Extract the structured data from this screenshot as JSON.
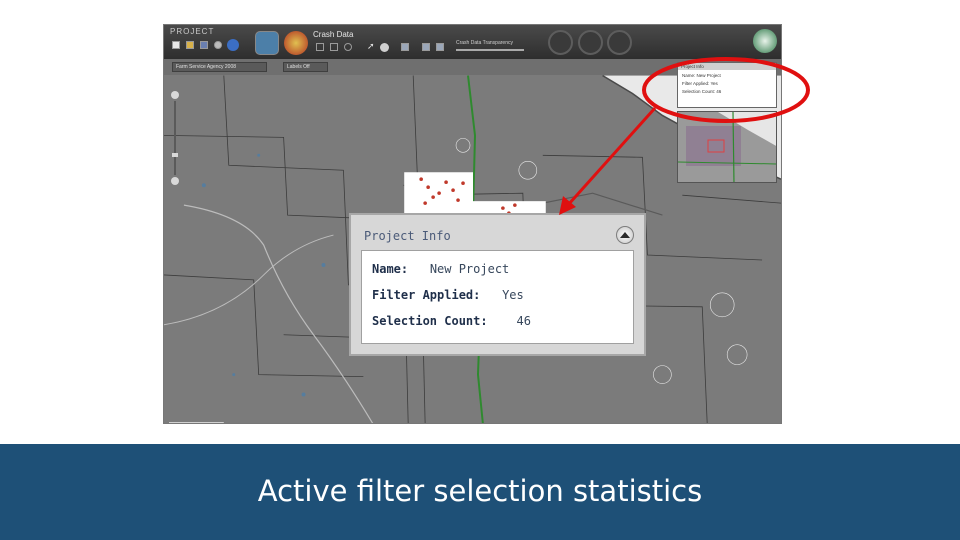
{
  "toolbar": {
    "project_label": "PROJECT",
    "crash_data_label": "Crash Data",
    "filter_text": "Crash Data   Transparency"
  },
  "subbar": {
    "layer_dropdown": "Farm Service Agency 2008",
    "labels_dropdown": "Labels Off"
  },
  "mini_panel": {
    "title": "Project Info",
    "name_label": "Name:",
    "name_value": "New Project",
    "filter_label": "Filter Applied:",
    "filter_value": "Yes",
    "count_label": "Selection Count:",
    "count_value": "46"
  },
  "zoom_panel": {
    "title": "Project Info",
    "name_label": "Name:",
    "name_value": "New Project",
    "filter_label": "Filter Applied:",
    "filter_value": "Yes",
    "count_label": "Selection Count:",
    "count_value": "46"
  },
  "caption": "Active filter selection statistics",
  "colors": {
    "banner": "#1e5077",
    "annotation": "#e01010",
    "map_background": "#7b7b7b",
    "panel_text": "#4a5a78",
    "highway": "#2f8a2f"
  },
  "icons": [
    "new-icon",
    "open-icon",
    "save-icon",
    "settings-icon",
    "help-icon",
    "layers-icon",
    "crash-data-icon",
    "select-tool-icon",
    "chart-icon",
    "report-icon",
    "state-logo-icon",
    "zoom-in-icon",
    "zoom-out-icon",
    "collapse-icon"
  ]
}
